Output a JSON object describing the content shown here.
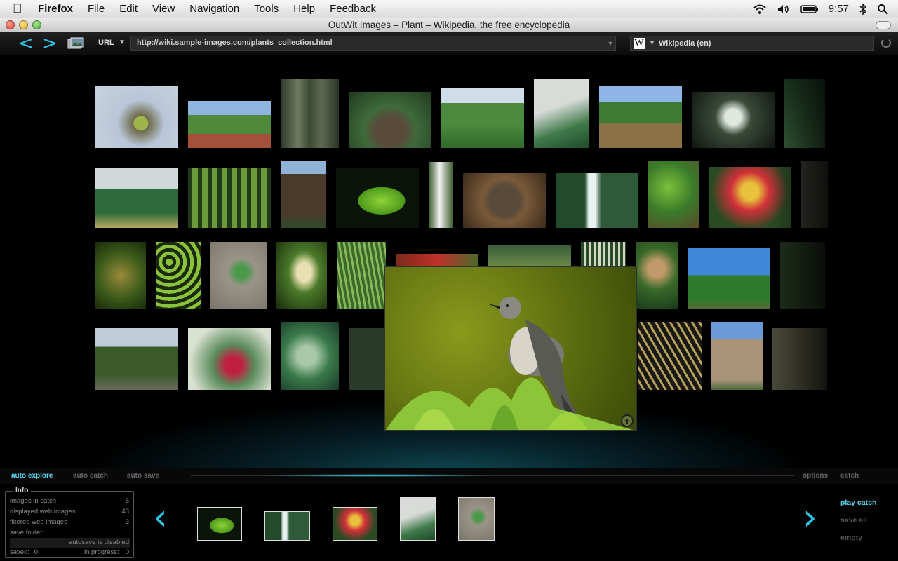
{
  "menubar": {
    "app": "Firefox",
    "menus": [
      "File",
      "Edit",
      "View",
      "Navigation",
      "Tools",
      "Help",
      "Feedback"
    ],
    "clock": "9:57"
  },
  "window": {
    "title": "OutWit Images – Plant – Wikipedia, the free encyclopedia"
  },
  "toolbar": {
    "url_label": "URL",
    "url_value": "http://wiki.sample-images.com/plants_collection.html",
    "source_label": "Wikipedia (en)",
    "source_icon": "W"
  },
  "tabs": {
    "auto_explore": "auto explore",
    "auto_catch": "auto catch",
    "auto_save": "auto save",
    "options": "options",
    "catch": "catch"
  },
  "info": {
    "title": "Info",
    "images_in_catch_label": "images in catch",
    "images_in_catch": "5",
    "displayed_label": "displayed web images",
    "displayed": "43",
    "filtered_label": "filtered web images",
    "filtered": "3",
    "save_folder_label": "save folder:",
    "autosave_status": "autosave is disabled",
    "saved_label": "saved:",
    "saved": "0",
    "in_progress_label": "in progress:",
    "in_progress": "0"
  },
  "actions": {
    "play_catch": "play catch",
    "save_all": "save all",
    "empty": "empty"
  },
  "colors": {
    "accent": "#2ec4e6",
    "active_text": "#5fd6f0"
  }
}
